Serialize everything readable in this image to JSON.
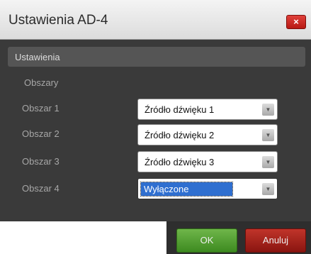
{
  "dialog": {
    "title": "Ustawienia AD-4",
    "close_label": "×"
  },
  "section": {
    "header": "Ustawienia",
    "group_label": "Obszary"
  },
  "rows": [
    {
      "label": "Obszar 1",
      "value": "Źródło dźwięku 1"
    },
    {
      "label": "Obszar 2",
      "value": "Źródło dźwięku 2"
    },
    {
      "label": "Obszar 3",
      "value": "Źródło dźwięku 3"
    },
    {
      "label": "Obszar 4",
      "value": "Wyłączone"
    }
  ],
  "buttons": {
    "ok": "OK",
    "cancel": "Anuluj"
  },
  "icons": {
    "dropdown_arrow": "▼"
  }
}
